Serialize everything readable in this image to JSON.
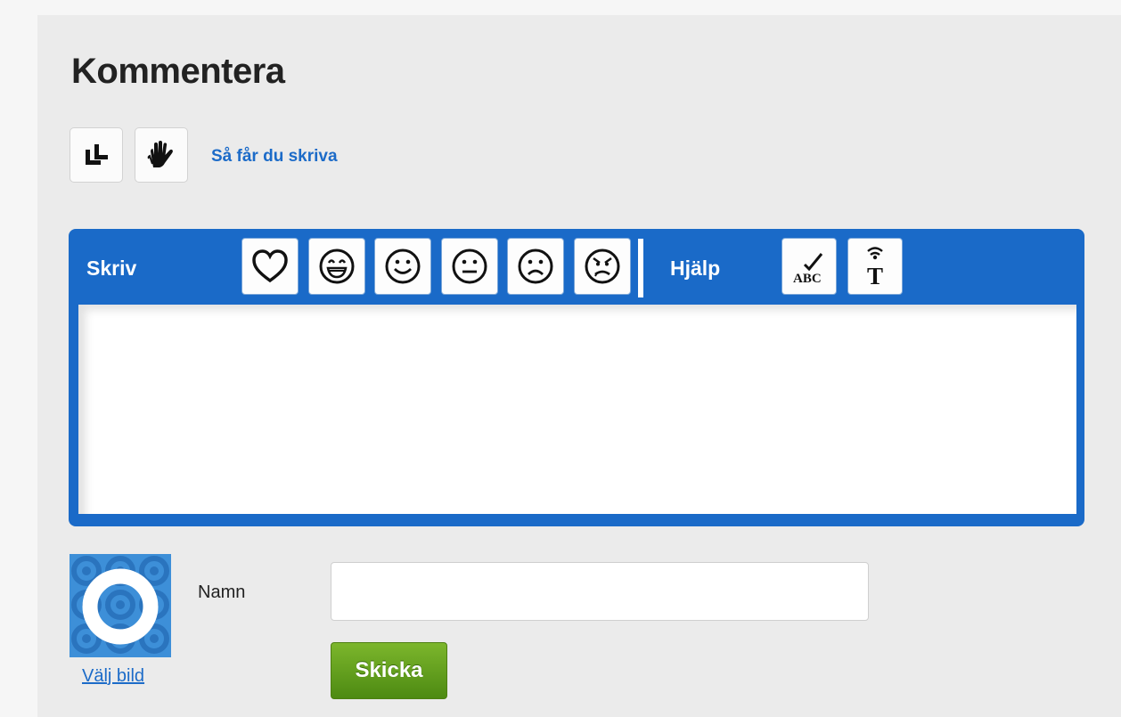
{
  "heading": "Kommentera",
  "tools": {
    "howto_link": "Så får du skriva"
  },
  "editor": {
    "write_label": "Skriv",
    "help_label": "Hjälp",
    "emojis": [
      "heart-icon",
      "laughing-face-icon",
      "smiling-face-icon",
      "neutral-face-icon",
      "sad-face-icon",
      "angry-face-icon"
    ],
    "help_tools": {
      "spellcheck_text": "ABC",
      "text_to_speech_text": "T"
    },
    "textarea_value": ""
  },
  "form": {
    "choose_image": "Välj bild",
    "name_label": "Namn",
    "name_value": "",
    "send_button": "Skicka"
  },
  "colors": {
    "accent": "#1a6ac8",
    "link": "#1c6bc8",
    "send_button": "#6aa322",
    "panel_bg": "#ebebeb"
  }
}
